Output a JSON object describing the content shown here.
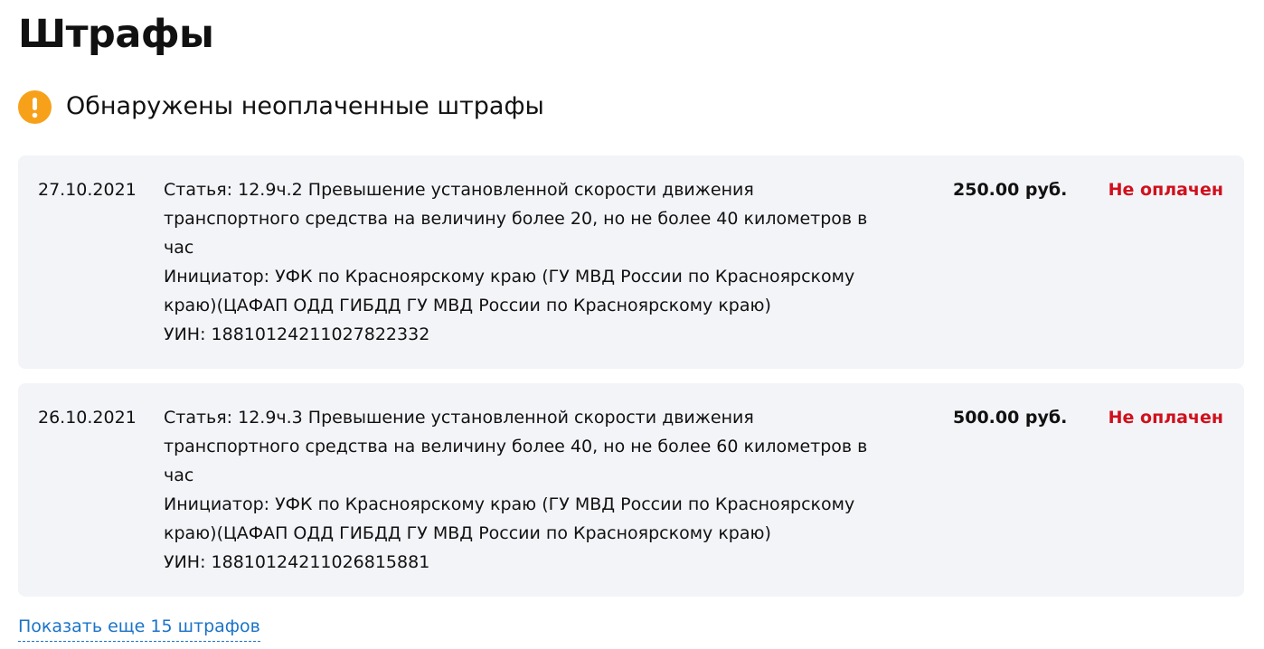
{
  "page": {
    "title": "Штрафы"
  },
  "alert": {
    "icon": "warning-exclamation-icon",
    "color": "#f7a11a",
    "text": "Обнаружены неоплаченные штрафы"
  },
  "fines": [
    {
      "date": "27.10.2021",
      "description_lines": [
        "Статья: 12.9ч.2 Превышение установленной скорости движения",
        "транспортного средства на величину более 20, но не более 40 километров в",
        "час",
        "Инициатор: УФК по Красноярскому краю (ГУ МВД России по Красноярскому",
        "краю)(ЦАФАП ОДД ГИБДД ГУ МВД России по Красноярскому краю)",
        "УИН: 18810124211027822332"
      ],
      "amount": "250.00 руб.",
      "status": "Не оплачен"
    },
    {
      "date": "26.10.2021",
      "description_lines": [
        "Статья: 12.9ч.3 Превышение установленной скорости движения",
        "транспортного средства на величину более 40, но не более 60 километров в",
        "час",
        "Инициатор: УФК по Красноярскому краю (ГУ МВД России по Красноярскому",
        "краю)(ЦАФАП ОДД ГИБДД ГУ МВД России по Красноярскому краю)",
        "УИН: 18810124211026815881"
      ],
      "amount": "500.00 руб.",
      "status": "Не оплачен"
    }
  ],
  "show_more": {
    "label": "Показать еще 15 штрафов"
  },
  "colors": {
    "status_unpaid": "#d0101c",
    "link": "#1a73c8",
    "card_background": "#f3f4f8"
  }
}
